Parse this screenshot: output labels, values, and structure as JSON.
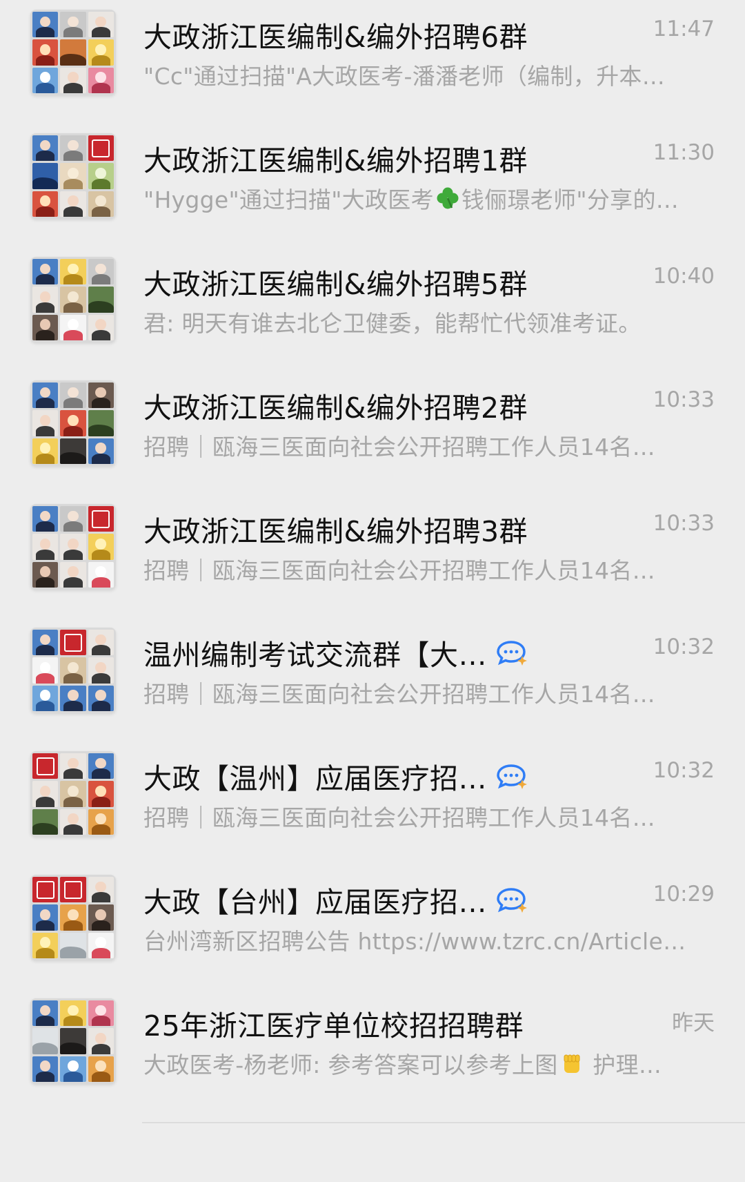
{
  "colors": {
    "background": "#ededed",
    "title": "#111111",
    "secondary": "#a6a6a6",
    "divider": "#dcdcdc",
    "seal_red": "#c8272d",
    "mention_blue": "#2f7df6"
  },
  "chats": [
    {
      "title": "大政浙江医编制&编外招聘6群",
      "time": "11:47",
      "preview": "\"Cc\"通过扫描\"A大政医考-潘潘老师（编制，升本…",
      "mention_icon": false,
      "avatar_tiles": [
        "person-blue",
        "person-grey",
        "person-light",
        "cartoon-red",
        "scene-orange",
        "cartoon-yellow",
        "cartoon-blue",
        "person-light",
        "cartoon-pink"
      ]
    },
    {
      "title": "大政浙江医编制&编外招聘1群",
      "time": "11:30",
      "preview_parts": [
        "\"Hygge\"通过扫描\"大政医考",
        "clover-emoji",
        "钱俪璟老师\"分享的…"
      ],
      "preview": "\"Hygge\"通过扫描\"大政医考🍀钱俪璟老师\"分享的…",
      "mention_icon": false,
      "avatar_tiles": [
        "person-blue",
        "person-grey",
        "seal-red",
        "scene-blue",
        "cartoon-light",
        "cartoon-green",
        "cartoon-red",
        "person-light",
        "cartoon-beige"
      ]
    },
    {
      "title": "大政浙江医编制&编外招聘5群",
      "time": "10:40",
      "preview": "君: 明天有谁去北仑卫健委，能帮忙代领准考证。",
      "mention_icon": false,
      "avatar_tiles": [
        "person-blue",
        "cartoon-yellow",
        "person-grey",
        "person-light",
        "cartoon-beige",
        "scene-green",
        "person-dark",
        "cartoon-white",
        "person-light"
      ]
    },
    {
      "title": "大政浙江医编制&编外招聘2群",
      "time": "10:33",
      "preview": "招聘｜瓯海三医面向社会公开招聘工作人员14名…",
      "mention_icon": false,
      "avatar_tiles": [
        "person-blue",
        "person-grey",
        "person-dark",
        "person-light",
        "cartoon-red",
        "scene-green",
        "cartoon-yellow",
        "scene-dark",
        "person-blue"
      ]
    },
    {
      "title": "大政浙江医编制&编外招聘3群",
      "time": "10:33",
      "preview": "招聘｜瓯海三医面向社会公开招聘工作人员14名…",
      "mention_icon": false,
      "avatar_tiles": [
        "person-blue",
        "person-grey",
        "seal-red",
        "person-light",
        "person-light",
        "cartoon-yellow",
        "person-dark",
        "person-light",
        "cartoon-white"
      ]
    },
    {
      "title": "温州编制考试交流群【大…",
      "time": "10:32",
      "preview": "招聘｜瓯海三医面向社会公开招聘工作人员14名…",
      "mention_icon": true,
      "avatar_tiles": [
        "person-blue",
        "seal-red",
        "person-light",
        "cartoon-white",
        "cartoon-beige",
        "person-light",
        "cartoon-blue",
        "person-blue",
        "person-blue"
      ]
    },
    {
      "title": "大政【温州】应届医疗招…",
      "time": "10:32",
      "preview": "招聘｜瓯海三医面向社会公开招聘工作人员14名…",
      "mention_icon": true,
      "avatar_tiles": [
        "seal-red",
        "person-light",
        "person-blue",
        "person-light",
        "cartoon-beige",
        "cartoon-red",
        "scene-green",
        "person-light",
        "cartoon-orange"
      ]
    },
    {
      "title": "大政【台州】应届医疗招…",
      "time": "10:29",
      "preview": "台州湾新区招聘公告 https://www.tzrc.cn/Article…",
      "mention_icon": true,
      "avatar_tiles": [
        "seal-red",
        "seal-red",
        "person-light",
        "person-blue",
        "cartoon-orange",
        "person-dark",
        "cartoon-yellow",
        "scene-light",
        "cartoon-white"
      ]
    },
    {
      "title": "25年浙江医疗单位校招招聘群",
      "time": "昨天",
      "preview_parts": [
        "大政医考-杨老师: 参考答案可以参考上图",
        "fist-emoji",
        " 护理…"
      ],
      "preview": "大政医考-杨老师: 参考答案可以参考上图✊ 护理…",
      "mention_icon": false,
      "avatar_tiles": [
        "person-blue",
        "cartoon-yellow",
        "cartoon-pink",
        "scene-light",
        "scene-dark",
        "person-light",
        "person-blue",
        "cartoon-blue",
        "cartoon-orange"
      ]
    }
  ]
}
